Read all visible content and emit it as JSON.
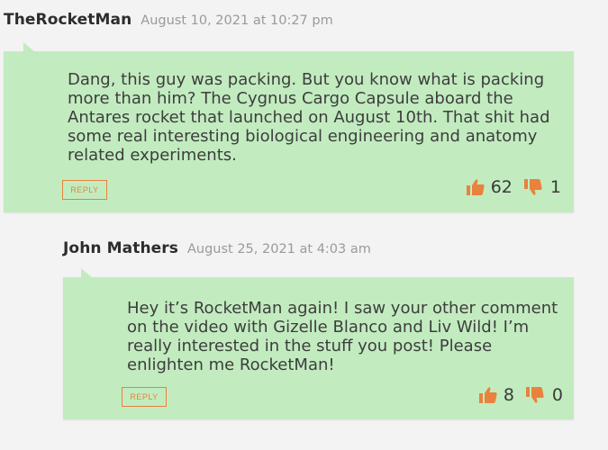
{
  "comments": [
    {
      "author": "TheRocketMan",
      "date": "August 10, 2021 at 10:27 pm",
      "lines": [
        "Dang, this guy was packing. But you know what is packing",
        "more than him? The Cygnus Cargo Capsule aboard the",
        "Antares rocket that launched on August 10th. That shit had",
        "some real interesting biological engineering and anatomy",
        "related experiments."
      ],
      "reply_label": "REPLY",
      "likes": "62",
      "dislikes": "1"
    },
    {
      "author": "John Mathers",
      "date": "August 25, 2021 at 4:03 am",
      "lines": [
        "Hey it’s RocketMan again! I saw your other comment",
        "on the video with Gizelle Blanco and Liv Wild! I’m",
        "really interested in the stuff you post! Please",
        "enlighten me RocketMan!"
      ],
      "reply_label": "REPLY",
      "likes": "8",
      "dislikes": "0"
    }
  ],
  "colors": {
    "bubble": "#c2ecbf",
    "accent": "#e8823d",
    "background": "#f3f3f3"
  },
  "icons": {
    "like": "thumbs-up-icon",
    "dislike": "thumbs-down-icon"
  }
}
